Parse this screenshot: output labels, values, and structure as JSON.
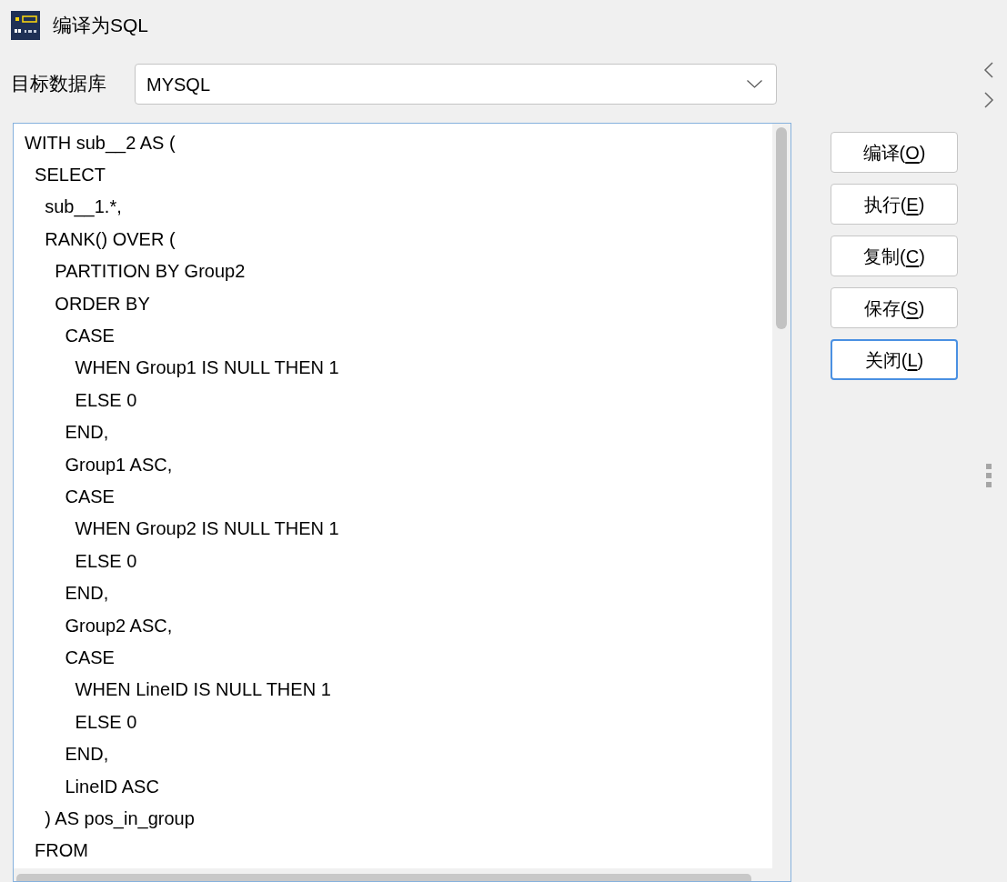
{
  "window": {
    "title": "编译为SQL"
  },
  "target_database": {
    "label": "目标数据库",
    "value": "MYSQL"
  },
  "code_lines": [
    "WITH sub__2 AS (",
    "  SELECT",
    "    sub__1.*,",
    "    RANK() OVER (",
    "      PARTITION BY Group2",
    "      ORDER BY",
    "        CASE",
    "          WHEN Group1 IS NULL THEN 1",
    "          ELSE 0",
    "        END,",
    "        Group1 ASC,",
    "        CASE",
    "          WHEN Group2 IS NULL THEN 1",
    "          ELSE 0",
    "        END,",
    "        Group2 ASC,",
    "        CASE",
    "          WHEN LineID IS NULL THEN 1",
    "          ELSE 0",
    "        END,",
    "        LineID ASC",
    "    ) AS pos_in_group",
    "  FROM"
  ],
  "buttons": [
    {
      "label_before": "编译(",
      "access_key": "O",
      "label_after": ")",
      "focused": false
    },
    {
      "label_before": "执行(",
      "access_key": "E",
      "label_after": ")",
      "focused": false
    },
    {
      "label_before": "复制(",
      "access_key": "C",
      "label_after": ")",
      "focused": false
    },
    {
      "label_before": "保存(",
      "access_key": "S",
      "label_after": ")",
      "focused": false
    },
    {
      "label_before": "关闭(",
      "access_key": "L",
      "label_after": ")",
      "focused": true
    }
  ]
}
